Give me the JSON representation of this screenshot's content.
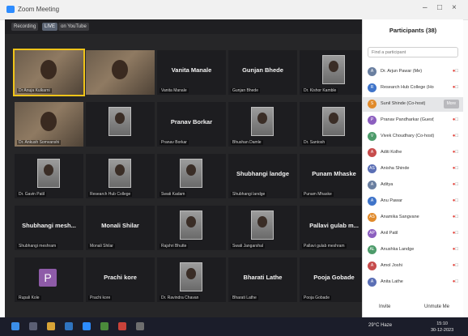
{
  "window": {
    "title": "Zoom Meeting",
    "controls": [
      "–",
      "□",
      "×"
    ]
  },
  "meeting_bar": {
    "recording_label": "Recording",
    "live_label": "LIVE",
    "youtube_label": "on YouTube"
  },
  "tiles": [
    {
      "name": "Dr Anuja Kulkarni",
      "type": "video"
    },
    {
      "name": "",
      "type": "video"
    },
    {
      "name": "Vanita Manale",
      "label": "Vanita Manale",
      "type": "text"
    },
    {
      "name": "Gunjan Bhede",
      "label": "Gunjan Bhede",
      "type": "text"
    },
    {
      "name": "Dr. Kishor Kamble",
      "type": "photo"
    },
    {
      "name": "Dr. Ankush Somvanshi",
      "type": "video"
    },
    {
      "name": "",
      "type": "photo"
    },
    {
      "name": "Pranav Borkar",
      "label": "Pranav Borkar",
      "type": "text"
    },
    {
      "name": "Bhushan Damle",
      "type": "photo"
    },
    {
      "name": "Dr. Santosh",
      "type": "photo"
    },
    {
      "name": "Dr. Gavin Patil",
      "type": "photo"
    },
    {
      "name": "Research Hub College",
      "type": "photo"
    },
    {
      "name": "Swati Kadam",
      "type": "photo"
    },
    {
      "name": "Shubhangi landge",
      "label": "Shubhangi landge",
      "type": "text"
    },
    {
      "name": "Punam Mhaske",
      "label": "Punam Mhaske",
      "type": "text"
    },
    {
      "name": "Shubhangi meshram",
      "label": "Shubhangi mesh...",
      "type": "text"
    },
    {
      "name": "Monali Shilar",
      "label": "Monali Shilar",
      "type": "text"
    },
    {
      "name": "Rajshri Bhutte",
      "type": "photo"
    },
    {
      "name": "Swati Jangarshal",
      "type": "photo"
    },
    {
      "name": "Pallavi gulab meshram",
      "label": "Pallavi gulab m...",
      "type": "text"
    },
    {
      "name": "Rupali Kole",
      "avatar_letter": "P",
      "type": "avatar"
    },
    {
      "name": "Prachi kore",
      "label": "Prachi kore",
      "type": "text"
    },
    {
      "name": "Dr. Ravindra Chavan",
      "type": "photo"
    },
    {
      "name": "Bharati Lathe",
      "label": "Bharati Lathe",
      "type": "text"
    },
    {
      "name": "Pooja Gobade",
      "label": "Pooja Gobade",
      "type": "text"
    }
  ],
  "participants_panel": {
    "title": "Participants (38)",
    "search_placeholder": "Find a participant",
    "rows": [
      {
        "name": "Dr. Arjun Pawar (Me)",
        "initials": "A",
        "selected": false
      },
      {
        "name": "Research Hub College (Host, me)",
        "initials": "R",
        "selected": false
      },
      {
        "name": "Sunil Shinde (Co-host)",
        "initials": "S",
        "selected": true
      },
      {
        "name": "Pranav Pandharkar (Guest)",
        "initials": "P",
        "selected": false
      },
      {
        "name": "Vivek Choudhary (Co-host)",
        "initials": "V",
        "selected": false
      },
      {
        "name": "Aditi Kolhe",
        "initials": "A",
        "selected": false
      },
      {
        "name": "Anisha Shinde",
        "initials": "AS",
        "selected": false
      },
      {
        "name": "Aditya",
        "initials": "A",
        "selected": false
      },
      {
        "name": "Anu Pawar",
        "initials": "A",
        "selected": false
      },
      {
        "name": "Anamika Sangvane",
        "initials": "AS",
        "selected": false
      },
      {
        "name": "Anil Patil",
        "initials": "AP",
        "selected": false
      },
      {
        "name": "Anushka Landge",
        "initials": "AL",
        "selected": false
      },
      {
        "name": "Amol Joshi",
        "initials": "A",
        "selected": false
      },
      {
        "name": "Anita Lathe",
        "initials": "A",
        "selected": false
      }
    ],
    "more_label": "More",
    "invite_label": "Invite",
    "mute_all_label": "Unmute Me"
  },
  "taskbar": {
    "weather": "29°C Haze",
    "time": "15:10",
    "date": "30-12-2023"
  }
}
